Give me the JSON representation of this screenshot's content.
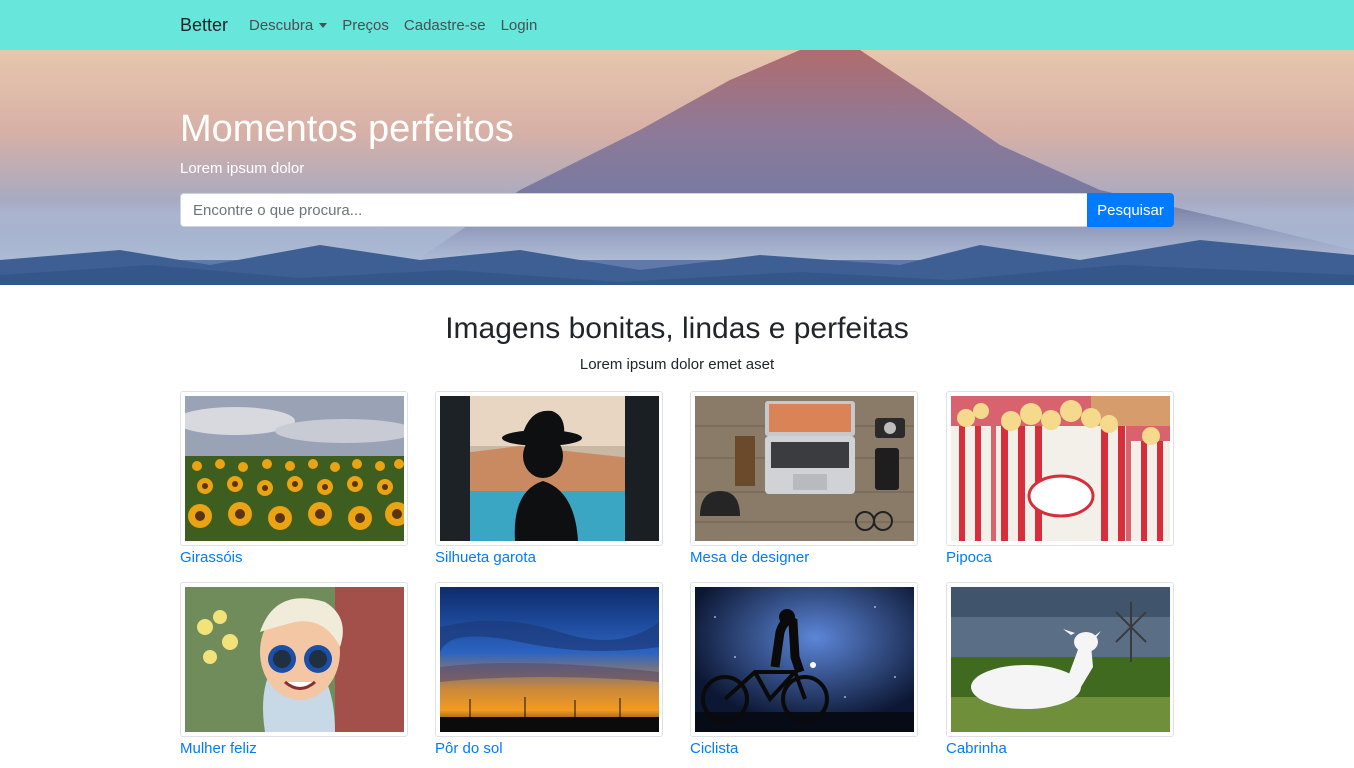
{
  "navbar": {
    "brand": "Better",
    "links": [
      {
        "label": "Descubra",
        "dropdown": true
      },
      {
        "label": "Preços"
      },
      {
        "label": "Cadastre-se"
      },
      {
        "label": "Login"
      }
    ],
    "bg_color": "#67e6dc"
  },
  "hero": {
    "title": "Momentos perfeitos",
    "subtitle": "Lorem ipsum dolor",
    "search_placeholder": "Encontre o que procura...",
    "search_button": "Pesquisar"
  },
  "gallery": {
    "title": "Imagens bonitas, lindas e perfeitas",
    "subtitle": "Lorem ipsum dolor emet aset",
    "items": [
      {
        "caption": "Girassóis",
        "icon": "sunflowers-image"
      },
      {
        "caption": "Silhueta garota",
        "icon": "girl-silhouette-image"
      },
      {
        "caption": "Mesa de designer",
        "icon": "designer-desk-image"
      },
      {
        "caption": "Pipoca",
        "icon": "popcorn-image"
      },
      {
        "caption": "Mulher feliz",
        "icon": "happy-woman-image"
      },
      {
        "caption": "Pôr do sol",
        "icon": "sunset-image"
      },
      {
        "caption": "Ciclista",
        "icon": "cyclist-image"
      },
      {
        "caption": "Cabrinha",
        "icon": "goat-image"
      }
    ]
  },
  "colors": {
    "accent": "#007bff"
  }
}
